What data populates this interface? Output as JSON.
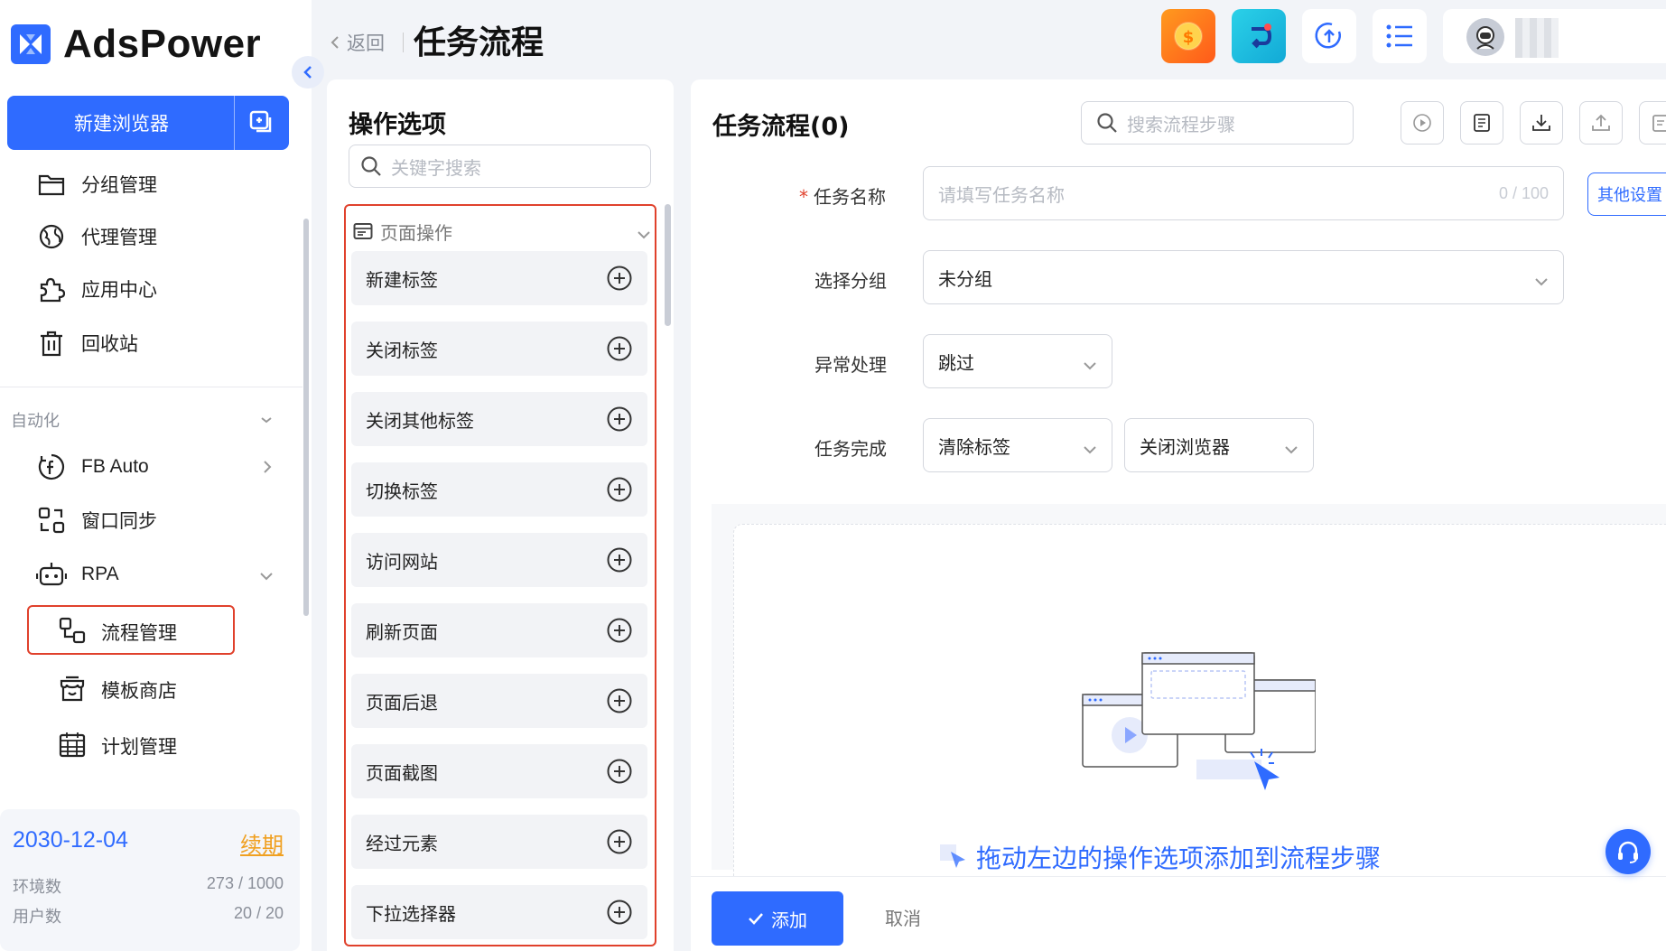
{
  "app": {
    "name": "AdsPower"
  },
  "sidebar": {
    "new_browser_label": "新建浏览器",
    "nav": [
      {
        "label": "分组管理",
        "icon": "folder-icon"
      },
      {
        "label": "代理管理",
        "icon": "globe-icon"
      },
      {
        "label": "应用中心",
        "icon": "puzzle-icon"
      },
      {
        "label": "回收站",
        "icon": "trash-icon"
      }
    ],
    "automation_label": "自动化",
    "automation_items": [
      {
        "label": "FB Auto",
        "icon": "facebook-icon"
      },
      {
        "label": "窗口同步",
        "icon": "sync-icon"
      },
      {
        "label": "RPA",
        "icon": "robot-icon"
      }
    ],
    "rpa_sub": [
      {
        "label": "流程管理",
        "icon": "flow-icon",
        "active": true
      },
      {
        "label": "模板商店",
        "icon": "store-icon"
      },
      {
        "label": "计划管理",
        "icon": "calendar-icon"
      }
    ],
    "plan": {
      "date": "2030-12-04",
      "renew_label": "续期",
      "env_label": "环境数",
      "env_value": "273 / 1000",
      "user_label": "用户数",
      "user_value": "20 / 20"
    }
  },
  "header": {
    "back_label": "返回",
    "title": "任务流程"
  },
  "ops": {
    "title": "操作选项",
    "search_placeholder": "关键字搜索",
    "category": "页面操作",
    "items": [
      "新建标签",
      "关闭标签",
      "关闭其他标签",
      "切换标签",
      "访问网站",
      "刷新页面",
      "页面后退",
      "页面截图",
      "经过元素",
      "下拉选择器"
    ]
  },
  "flow": {
    "title": "任务流程(0)",
    "search_placeholder": "搜索流程步骤",
    "task_name_label": "任务名称",
    "task_name_placeholder": "请填写任务名称",
    "task_name_count": "0 / 100",
    "other_settings": "其他设置",
    "group_label": "选择分组",
    "group_value": "未分组",
    "error_label": "异常处理",
    "error_value": "跳过",
    "finish_label": "任务完成",
    "finish_value1": "清除标签",
    "finish_value2": "关闭浏览器",
    "drop_hint": "拖动左边的操作选项添加到流程步骤",
    "add_label": "添加",
    "cancel_label": "取消"
  },
  "colors": {
    "accent": "#2f6bff",
    "highlight": "#e0412c",
    "renew": "#f0a020"
  }
}
